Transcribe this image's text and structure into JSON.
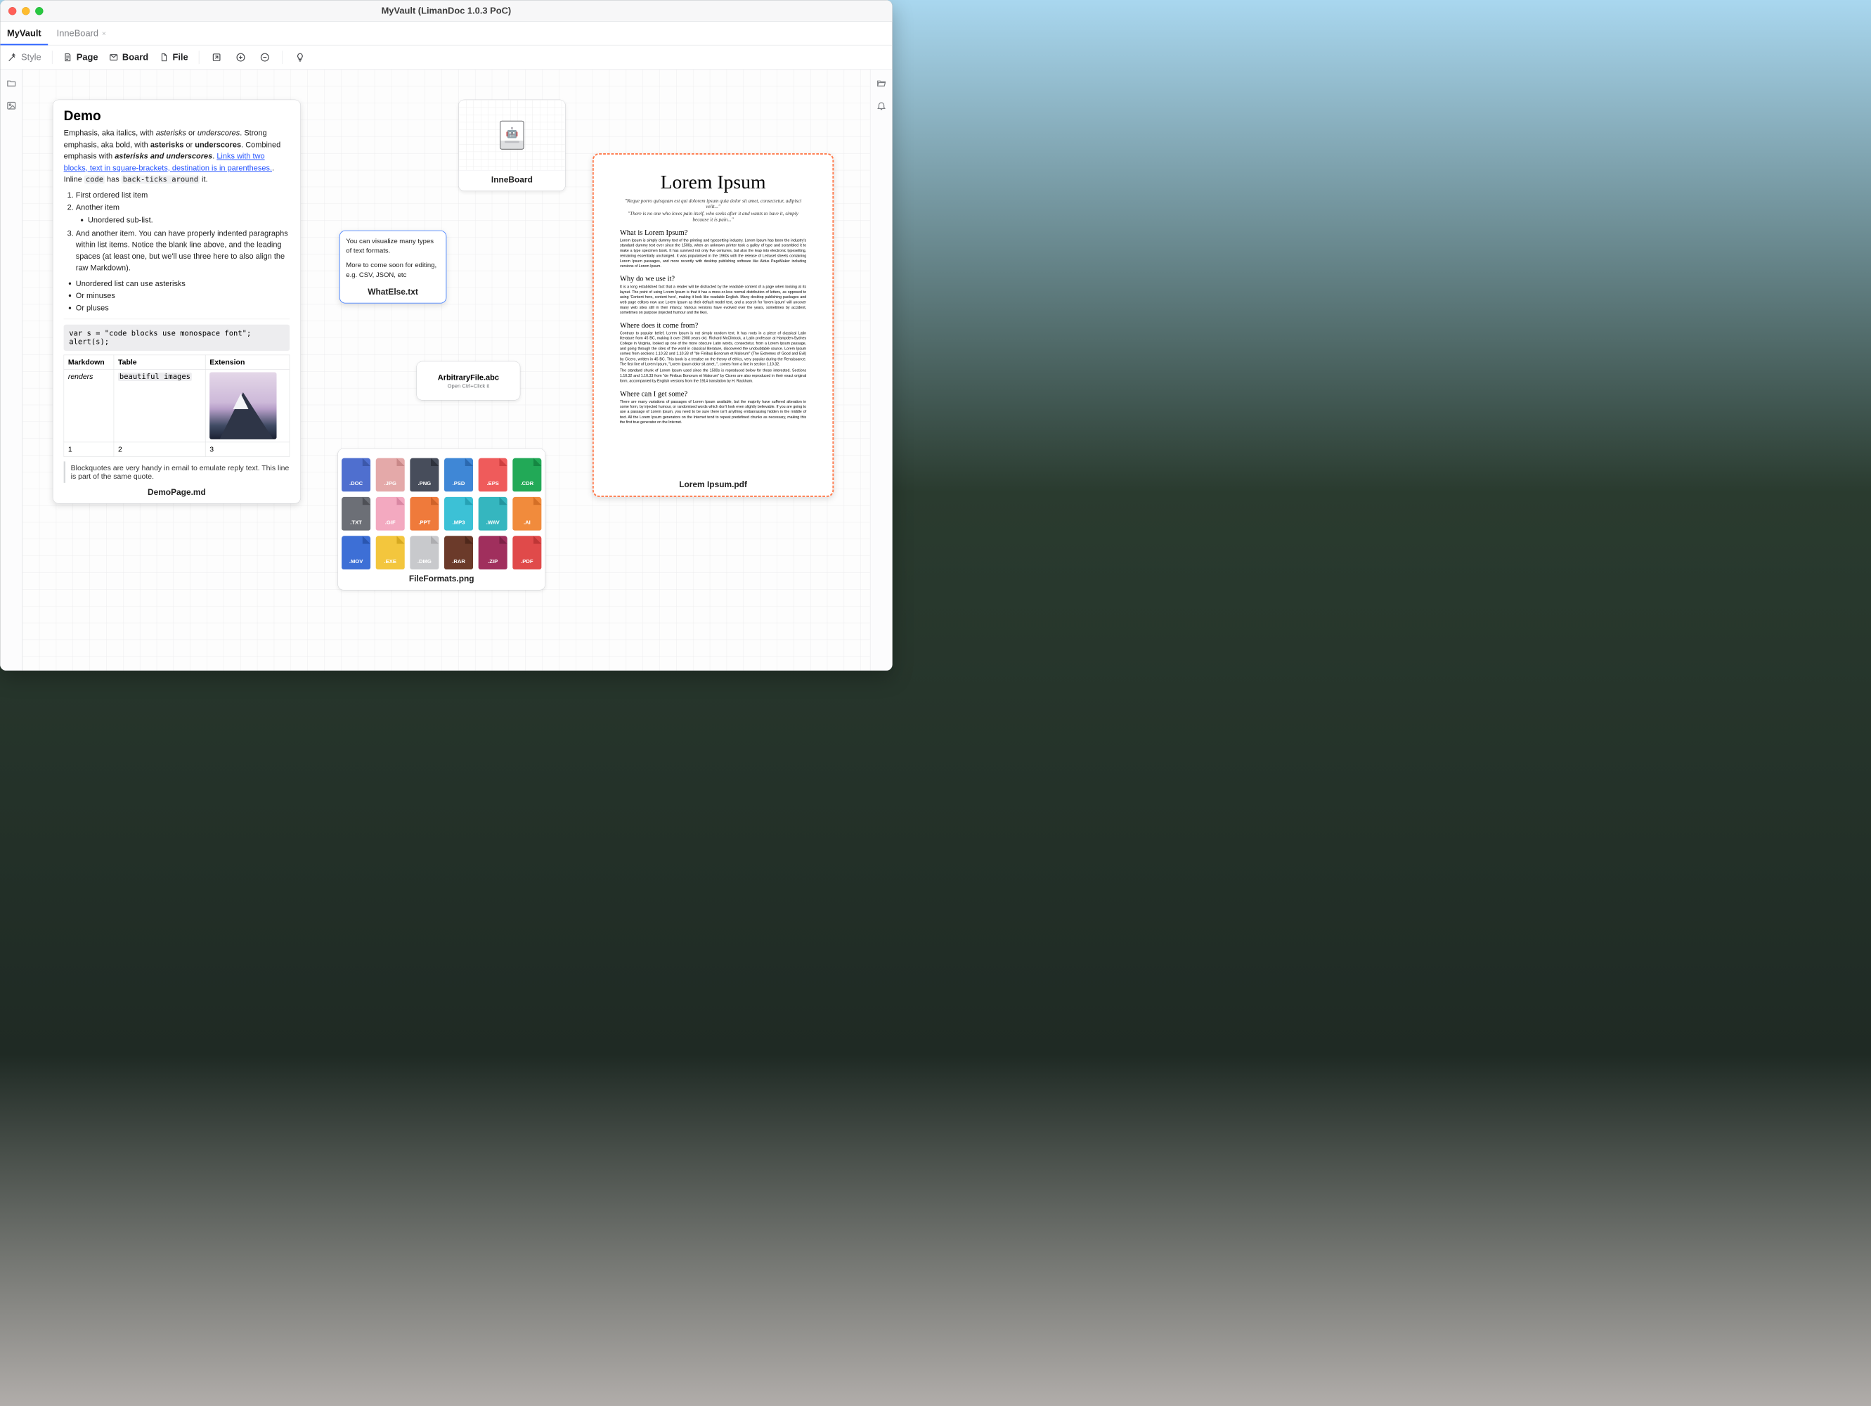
{
  "window": {
    "title": "MyVault (LimanDoc 1.0.3 PoC)"
  },
  "tabs": {
    "items": [
      {
        "label": "MyVault",
        "active": true
      },
      {
        "label": "InneBoard",
        "active": false
      }
    ]
  },
  "toolbar": {
    "style": "Style",
    "page": "Page",
    "board": "Board",
    "file": "File"
  },
  "cards": {
    "demo": {
      "filename": "DemoPage.md",
      "heading": "Demo",
      "para": {
        "seg1": "Emphasis, aka italics, with ",
        "asterisks_em": "asterisks",
        "or1": " or ",
        "underscores_em": "underscores",
        "seg2": ". Strong emphasis, aka bold, with ",
        "asterisks_b": "asterisks",
        "or2": " or ",
        "underscores_b": "underscores",
        "seg3": ". Combined emphasis with ",
        "combined": "asterisks and underscores",
        "seg4": ". ",
        "link": "Links with two blocks, text in square-brackets, destination is in parentheses.",
        "seg5": ". Inline ",
        "code1": "code",
        "has": " has ",
        "code2": "back-ticks around",
        "it": " it."
      },
      "ol": [
        "First ordered list item",
        "Another item",
        "And another item. You can have properly indented paragraphs within list items. Notice the blank line above, and the leading spaces (at least one, but we'll use three here to also align the raw Markdown)."
      ],
      "ol_sub_of_2": "Unordered sub-list.",
      "ul": [
        "Unordered list can use asterisks",
        "Or minuses",
        "Or pluses"
      ],
      "code": "var s = \"code blocks use monospace font\";\nalert(s);",
      "table": {
        "headers": [
          "Markdown",
          "Table",
          "Extension"
        ],
        "rows": [
          [
            "renders",
            "beautiful images",
            "image"
          ],
          [
            "1",
            "2",
            "3"
          ]
        ]
      },
      "blockquote": "Blockquotes are very handy in email to emulate reply text. This line is part of the same quote."
    },
    "inne": {
      "label": "InneBoard"
    },
    "txt": {
      "filename": "WhatElse.txt",
      "line1": "You can visualize many types of text formats.",
      "line2": "More to come soon for editing, e.g. CSV, JSON, etc"
    },
    "abc": {
      "title": "ArbitraryFile.abc",
      "hint": "Open Ctrl+Click it"
    },
    "fmt": {
      "filename": "FileFormats.png",
      "items": [
        {
          "ext": ".DOC",
          "c": "c-doc"
        },
        {
          "ext": ".JPG",
          "c": "c-jpg"
        },
        {
          "ext": ".PNG",
          "c": "c-png"
        },
        {
          "ext": ".PSD",
          "c": "c-psd"
        },
        {
          "ext": ".EPS",
          "c": "c-eps"
        },
        {
          "ext": ".CDR",
          "c": "c-cdr"
        },
        {
          "ext": ".TXT",
          "c": "c-txt"
        },
        {
          "ext": ".GIF",
          "c": "c-gif"
        },
        {
          "ext": ".PPT",
          "c": "c-ppt"
        },
        {
          "ext": ".MP3",
          "c": "c-mp3"
        },
        {
          "ext": ".WAV",
          "c": "c-wav"
        },
        {
          "ext": ".AI",
          "c": "c-ai"
        },
        {
          "ext": ".MOV",
          "c": "c-mov"
        },
        {
          "ext": ".EXE",
          "c": "c-exe"
        },
        {
          "ext": ".DMG",
          "c": "c-dmg"
        },
        {
          "ext": ".RAR",
          "c": "c-rar"
        },
        {
          "ext": ".ZIP",
          "c": "c-zip"
        },
        {
          "ext": ".PDF",
          "c": "c-pdf"
        }
      ]
    },
    "pdf": {
      "filename": "Lorem Ipsum.pdf",
      "title": "Lorem Ipsum",
      "quote1": "\"Neque porro quisquam est qui dolorem ipsum quia dolor sit amet, consectetur, adipisci velit...\"",
      "quote2": "\"There is no one who loves pain itself, who seeks after it and wants to have it, simply because it is pain...\"",
      "sections": [
        {
          "h": "What is Lorem Ipsum?",
          "p": "Lorem Ipsum is simply dummy text of the printing and typesetting industry. Lorem Ipsum has been the industry's standard dummy text ever since the 1500s, when an unknown printer took a galley of type and scrambled it to make a type specimen book. It has survived not only five centuries, but also the leap into electronic typesetting, remaining essentially unchanged. It was popularised in the 1960s with the release of Letraset sheets containing Lorem Ipsum passages, and more recently with desktop publishing software like Aldus PageMaker including versions of Lorem Ipsum."
        },
        {
          "h": "Why do we use it?",
          "p": "It is a long established fact that a reader will be distracted by the readable content of a page when looking at its layout. The point of using Lorem Ipsum is that it has a more-or-less normal distribution of letters, as opposed to using 'Content here, content here', making it look like readable English. Many desktop publishing packages and web page editors now use Lorem Ipsum as their default model text, and a search for 'lorem ipsum' will uncover many web sites still in their infancy. Various versions have evolved over the years, sometimes by accident, sometimes on purpose (injected humour and the like)."
        },
        {
          "h": "Where does it come from?",
          "p": "Contrary to popular belief, Lorem Ipsum is not simply random text. It has roots in a piece of classical Latin literature from 45 BC, making it over 2000 years old. Richard McClintock, a Latin professor at Hampden-Sydney College in Virginia, looked up one of the more obscure Latin words, consectetur, from a Lorem Ipsum passage, and going through the cites of the word in classical literature, discovered the undoubtable source. Lorem Ipsum comes from sections 1.10.32 and 1.10.33 of \"de Finibus Bonorum et Malorum\" (The Extremes of Good and Evil) by Cicero, written in 45 BC. This book is a treatise on the theory of ethics, very popular during the Renaissance. The first line of Lorem Ipsum, \"Lorem ipsum dolor sit amet..\", comes from a line in section 1.10.32.",
          "p2": "The standard chunk of Lorem Ipsum used since the 1500s is reproduced below for those interested. Sections 1.10.32 and 1.10.33 from \"de Finibus Bonorum et Malorum\" by Cicero are also reproduced in their exact original form, accompanied by English versions from the 1914 translation by H. Rackham."
        },
        {
          "h": "Where can I get some?",
          "p": "There are many variations of passages of Lorem Ipsum available, but the majority have suffered alteration in some form, by injected humour, or randomised words which don't look even slightly believable. If you are going to use a passage of Lorem Ipsum, you need to be sure there isn't anything embarrassing hidden in the middle of text. All the Lorem Ipsum generators on the Internet tend to repeat predefined chunks as necessary, making this the first true generator on the Internet."
        }
      ]
    }
  }
}
